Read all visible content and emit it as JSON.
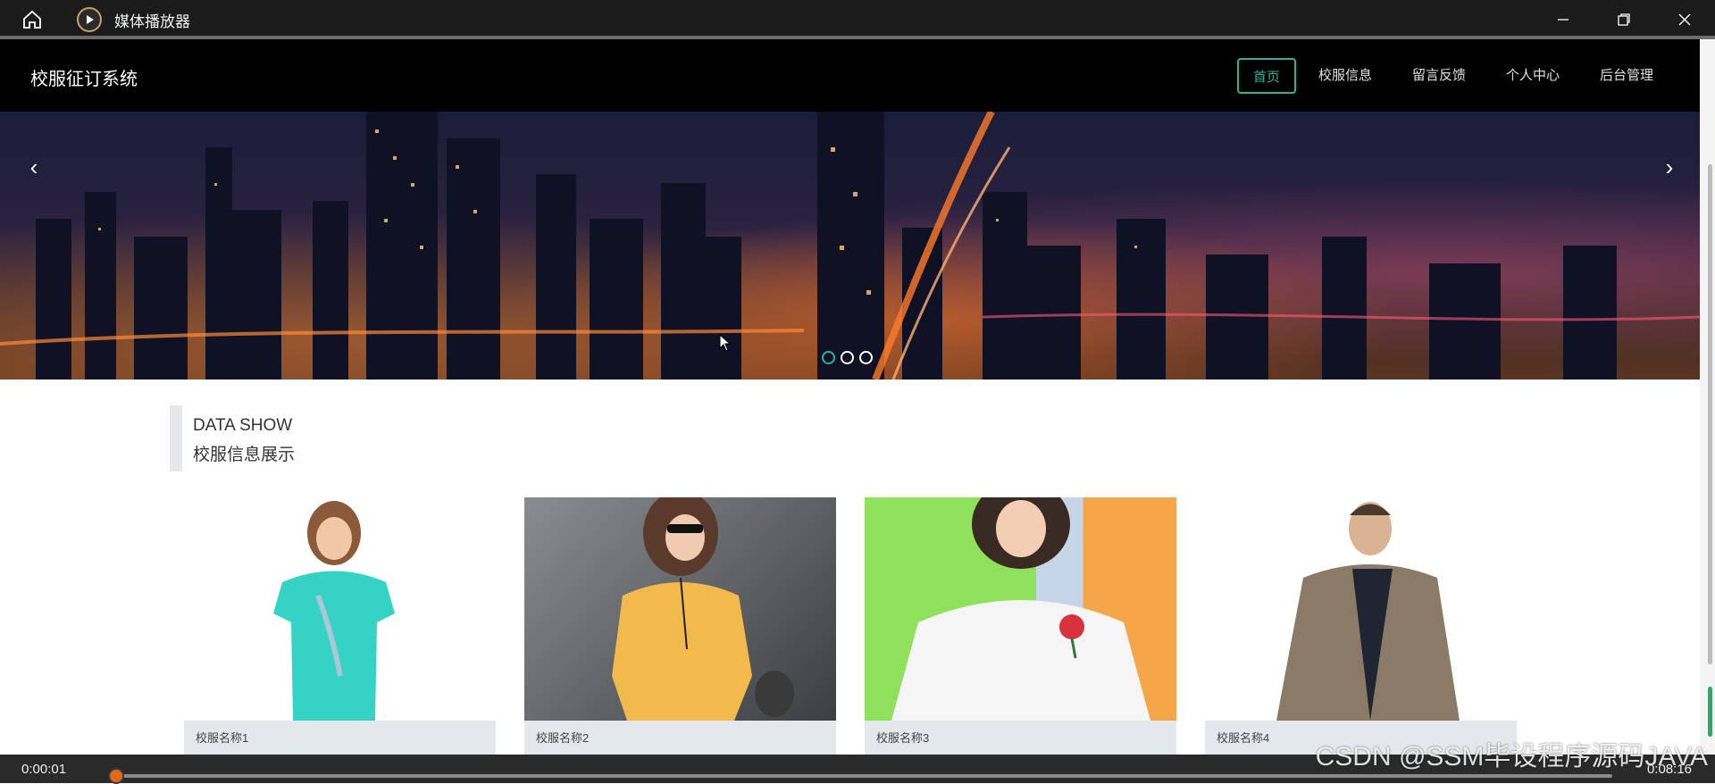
{
  "window": {
    "title": "媒体播放器",
    "controls": [
      "minimize",
      "restore",
      "close"
    ]
  },
  "site": {
    "brand": "校服征订系统",
    "menu": [
      {
        "label": "首页",
        "active": true
      },
      {
        "label": "校服信息",
        "active": false
      },
      {
        "label": "留言反馈",
        "active": false
      },
      {
        "label": "个人中心",
        "active": false
      },
      {
        "label": "后台管理",
        "active": false
      }
    ],
    "banner": {
      "slides": 3,
      "active_slide": 1
    },
    "section": {
      "title_en": "DATA SHOW",
      "title_cn": "校服信息展示"
    },
    "products": [
      {
        "name": "校服名称1"
      },
      {
        "name": "校服名称2"
      },
      {
        "name": "校服名称3"
      },
      {
        "name": "校服名称4"
      }
    ]
  },
  "player": {
    "current_time": "0:00:01",
    "total_time": "0:08:16",
    "progress": 0.002
  },
  "watermark": "CSDN @SSM毕设程序源码JAVA",
  "colors": {
    "accent": "#2bb39a",
    "nav_bg": "#000000",
    "caption_bg": "#e4e7eb",
    "player_thumb": "#e06a1b"
  }
}
